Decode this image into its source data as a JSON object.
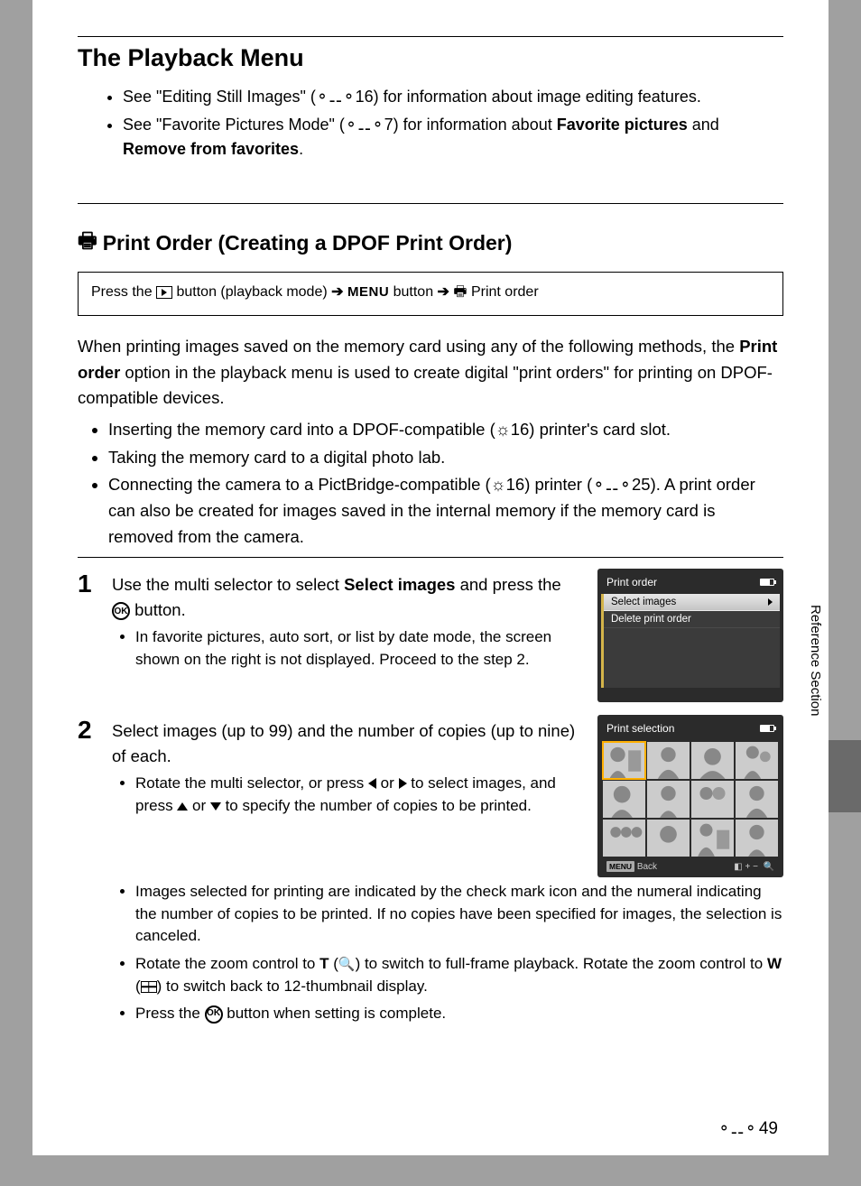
{
  "title": "The Playback Menu",
  "intro": {
    "item1_a": "See \"Editing Still Images\" (",
    "item1_ref": "16",
    "item1_b": ") for information about image editing features.",
    "item2_a": "See \"Favorite Pictures Mode\" (",
    "item2_ref": "7",
    "item2_b": ") for information about ",
    "item2_bold1": "Favorite pictures",
    "item2_c": " and ",
    "item2_bold2": "Remove from favorites",
    "item2_d": "."
  },
  "section": {
    "icon": "a",
    "title": "Print Order (Creating a DPOF Print Order)",
    "nav_a": "Press the ",
    "nav_b": " button (playback mode) ",
    "nav_arrow": "➔",
    "nav_menu": "MENU",
    "nav_c": " button ",
    "nav_print_icon": "a",
    "nav_d": " Print order"
  },
  "para1_a": "When printing images saved on the memory card using any of the following methods, the ",
  "para1_bold": "Print order",
  "para1_b": " option in the playback menu is used to create digital \"print orders\" for printing on DPOF-compatible devices.",
  "list2": {
    "i1_a": "Inserting the memory card into a DPOF-compatible (",
    "i1_ref": "16",
    "i1_b": ") printer's card slot.",
    "i2": "Taking the memory card to a digital photo lab.",
    "i3_a": "Connecting the camera to a PictBridge-compatible (",
    "i3_ref1": "16",
    "i3_b": ") printer (",
    "i3_ref2": "25",
    "i3_c": "). A print order can also be created for images saved in the internal memory if the memory card is removed from the camera."
  },
  "step1": {
    "num": "1",
    "title_a": "Use the multi selector to select ",
    "title_bold": "Select images",
    "title_b": " and press the ",
    "title_c": " button.",
    "sub1": "In favorite pictures, auto sort, or list by date mode, the screen shown on the right is not displayed. Proceed to the step 2.",
    "screen": {
      "header": "Print order",
      "item_sel": "Select images",
      "item2": "Delete print order"
    }
  },
  "step2": {
    "num": "2",
    "title": "Select images (up to 99) and the number of copies (up to nine) of each.",
    "sub1_a": "Rotate the multi selector, or press ",
    "sub1_b": " or ",
    "sub1_c": " to select images, and press ",
    "sub1_d": " or ",
    "sub1_e": " to specify the number of copies to be printed.",
    "sub2": "Images selected for printing are indicated by the check mark icon and the numeral indicating the number of copies to be printed. If no copies have been specified for images, the selection is canceled.",
    "sub3_a": "Rotate the zoom control to ",
    "sub3_T": "T",
    "sub3_b": " (",
    "sub3_c": ") to switch to full-frame playback. Rotate the zoom control to ",
    "sub3_W": "W",
    "sub3_d": " (",
    "sub3_e": ") to switch back to 12-thumbnail display.",
    "sub4_a": "Press the ",
    "sub4_b": " button when setting is complete.",
    "screen": {
      "header": "Print selection",
      "back": "Back",
      "right": "+ −"
    }
  },
  "side_label": "Reference Section",
  "page_number": "49"
}
